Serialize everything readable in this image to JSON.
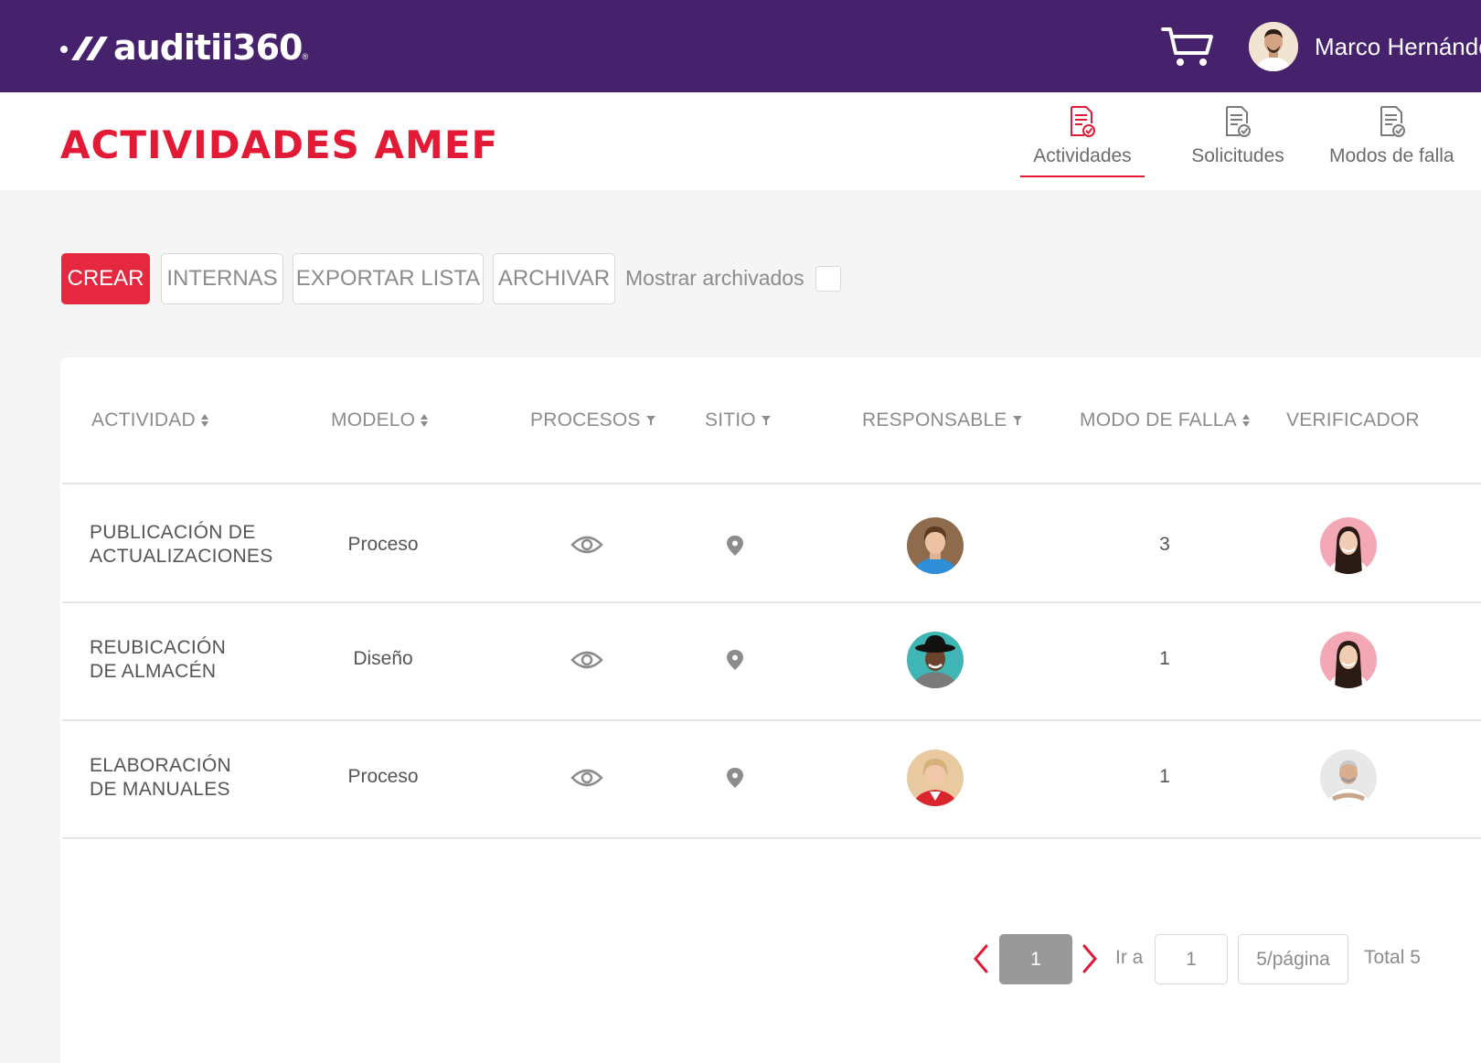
{
  "app": {
    "logo_text": "auditii360",
    "logo_reg": "®"
  },
  "topbar": {
    "user_name": "Marco Hernández",
    "background": "#46226c"
  },
  "header": {
    "title": "ACTIVIDADES AMEF",
    "tabs": [
      {
        "label": "Actividades",
        "active": true,
        "icon": "document-check-icon"
      },
      {
        "label": "Solicitudes",
        "active": false,
        "icon": "document-check-icon"
      },
      {
        "label": "Modos de falla",
        "active": false,
        "icon": "document-check-icon"
      }
    ]
  },
  "toolbar": {
    "create": "CREAR",
    "internal": "INTERNAS",
    "export": "EXPORTAR LISTA",
    "archive": "ARCHIVAR",
    "show_archived": "Mostrar archivados",
    "show_archived_checked": false
  },
  "table": {
    "columns": [
      {
        "label": "ACTIVIDAD",
        "control": "sort"
      },
      {
        "label": "MODELO",
        "control": "sort"
      },
      {
        "label": "PROCESOS",
        "control": "filter"
      },
      {
        "label": "SITIO",
        "control": "filter"
      },
      {
        "label": "RESPONSABLE",
        "control": "filter"
      },
      {
        "label": "MODO DE FALLA",
        "control": "sort"
      },
      {
        "label": "VERIFICADOR",
        "control": "none"
      }
    ],
    "rows": [
      {
        "activity_line1": "PUBLICACIÓN DE",
        "activity_line2": "ACTUALIZACIONES",
        "model": "Proceso",
        "failure_modes": "3",
        "responsible_avatar": "woman-blue-shirt",
        "verifier_avatar": "woman-pink-background"
      },
      {
        "activity_line1": "REUBICACIÓN",
        "activity_line2": "DE ALMACÉN",
        "model": "Diseño",
        "failure_modes": "1",
        "responsible_avatar": "man-black-hat",
        "verifier_avatar": "woman-pink-background"
      },
      {
        "activity_line1": "ELABORACIÓN",
        "activity_line2": "DE MANUALES",
        "model": "Proceso",
        "failure_modes": "1",
        "responsible_avatar": "woman-red-jacket",
        "verifier_avatar": "older-man-white-shirt"
      }
    ]
  },
  "pagination": {
    "current_page": "1",
    "goto_label": "Ir a",
    "goto_value": "1",
    "page_size": "5/página",
    "total": "Total 5"
  },
  "colors": {
    "accent": "#e21a36",
    "primary_button": "#e5273f",
    "topbar": "#46226c"
  }
}
